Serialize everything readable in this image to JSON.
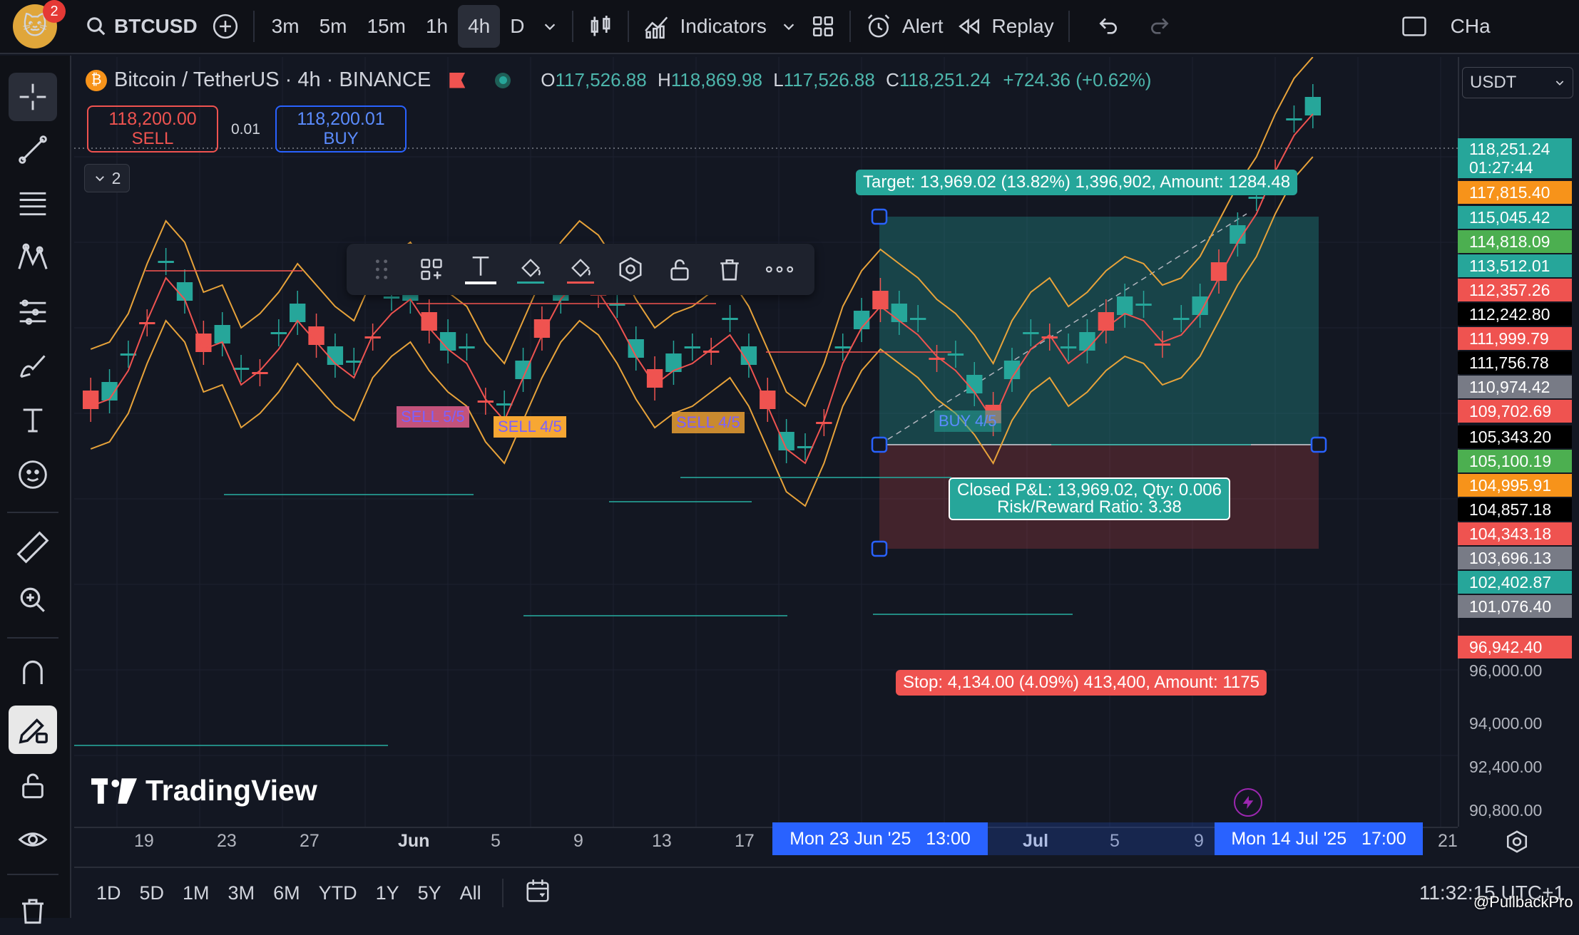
{
  "colors": {
    "up": "#26a69a",
    "down": "#ef5350",
    "accent": "#2962ff",
    "bg": "#131722",
    "upper_band": "#e8a33a"
  },
  "topbar": {
    "notification_count": "2",
    "symbol": "BTCUSD",
    "timeframes": [
      "3m",
      "5m",
      "15m",
      "1h",
      "4h",
      "D"
    ],
    "active_timeframe": "4h",
    "indicators_label": "Indicators",
    "alert_label": "Alert",
    "replay_label": "Replay",
    "right_text": "CHa"
  },
  "legend": {
    "title": "Bitcoin / TetherUS · 4h · BINANCE",
    "o_label": "O",
    "o_value": "117,526.88",
    "h_label": "H",
    "h_value": "118,869.98",
    "l_label": "L",
    "l_value": "117,526.88",
    "c_label": "C",
    "c_value": "118,251.24",
    "change": "+724.36 (+0.62%)",
    "indicator_count": "2"
  },
  "trade": {
    "sell_price": "118,200.00",
    "sell_label": "SELL",
    "spread": "0.01",
    "buy_price": "118,200.01",
    "buy_label": "BUY"
  },
  "currency_select": "USDT",
  "position": {
    "target": "Target: 13,969.02 (13.82%) 1,396,902, Amount: 1284.48",
    "closed_pnl_line1": "Closed P&L: 13,969.02, Qty: 0.006",
    "closed_pnl_line2": "Risk/Reward Ratio: 3.38",
    "stop": "Stop: 4,134.00 (4.09%) 413,400, Amount: 1175"
  },
  "signals": [
    "SELL 5/5",
    "SELL 4/5",
    "SELL 4/5",
    "BUY 4/5"
  ],
  "price_labels": [
    {
      "text": "118,251.24",
      "sub": "01:27:44",
      "color": "#26a69a"
    },
    {
      "text": "117,815.40",
      "color": "#f7931a"
    },
    {
      "text": "115,045.42",
      "color": "#26a69a"
    },
    {
      "text": "114,818.09",
      "color": "#4caf50"
    },
    {
      "text": "113,512.01",
      "color": "#26a69a"
    },
    {
      "text": "112,357.26",
      "color": "#ef5350"
    },
    {
      "text": "112,242.80",
      "color": "#000000"
    },
    {
      "text": "111,999.79",
      "color": "#ef5350"
    },
    {
      "text": "111,756.78",
      "color": "#000000"
    },
    {
      "text": "110,974.42",
      "color": "#787b86"
    },
    {
      "text": "109,702.69",
      "color": "#ef5350"
    },
    {
      "text": "105,343.20",
      "color": "#000000"
    },
    {
      "text": "105,100.19",
      "color": "#4caf50"
    },
    {
      "text": "104,995.91",
      "color": "#f7931a"
    },
    {
      "text": "104,857.18",
      "color": "#000000"
    },
    {
      "text": "104,343.18",
      "color": "#ef5350"
    },
    {
      "text": "103,696.13",
      "color": "#787b86"
    },
    {
      "text": "102,402.87",
      "color": "#26a69a"
    },
    {
      "text": "101,076.40",
      "color": "#787b86"
    },
    {
      "text": "96,942.40",
      "color": "#ef5350"
    }
  ],
  "price_ticks": [
    "96,000.00",
    "94,000.00",
    "92,400.00",
    "90,800.00"
  ],
  "time_ticks": [
    "19",
    "23",
    "27",
    "Jun",
    "5",
    "9",
    "13",
    "17",
    "Jul",
    "5",
    "9",
    "21"
  ],
  "time_highlights": [
    "Mon 23 Jun '25   13:00",
    "Mon 14 Jul '25   17:00"
  ],
  "bottombar": {
    "ranges": [
      "1D",
      "5D",
      "1M",
      "3M",
      "6M",
      "YTD",
      "1Y",
      "5Y",
      "All"
    ],
    "clock": "11:32:15 UTC+1"
  },
  "watermark": "TradingView",
  "attribution": "@PullbackPro"
}
